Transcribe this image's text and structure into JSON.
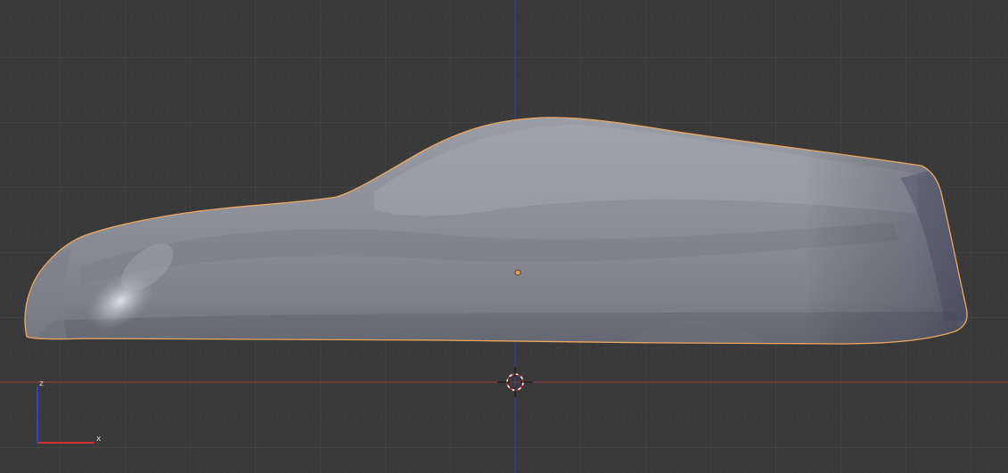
{
  "viewport": {
    "background_color": "#393939",
    "grid_color": "#444444",
    "x_axis_color": "#a33a3a",
    "z_axis_color": "#3a3aa3",
    "selection_outline_color": "#f0a860",
    "mesh_base_color": "#8a8c96"
  },
  "gizmo": {
    "x_label": "x",
    "z_label": "z",
    "x_color": "#d03030",
    "z_color": "#3040e0"
  },
  "icons": {
    "cursor": "3d-cursor-icon",
    "origin": "object-origin-icon"
  }
}
